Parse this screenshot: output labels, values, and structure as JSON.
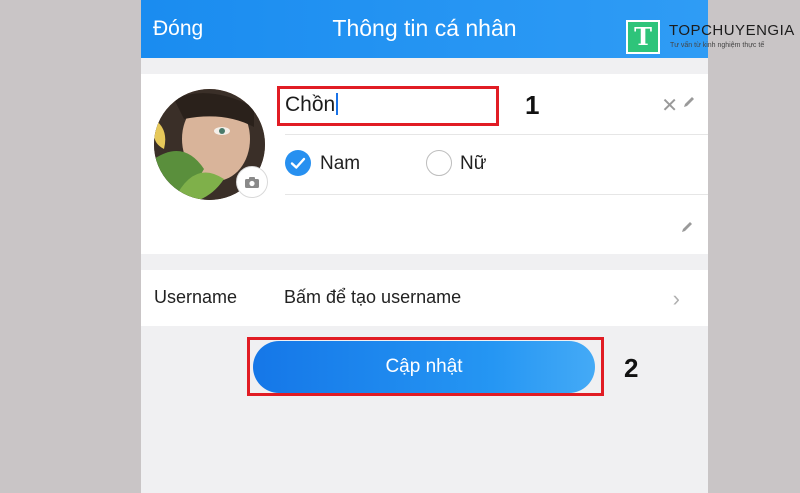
{
  "header": {
    "back_label": "Đóng",
    "title": "Thông tin cá nhân"
  },
  "profile": {
    "name_value": "Chồn",
    "gender_options": [
      {
        "label": "Nam",
        "selected": true
      },
      {
        "label": "Nữ",
        "selected": false
      }
    ]
  },
  "username_row": {
    "label": "Username",
    "value": "Bấm để tạo username"
  },
  "update_button": {
    "label": "Cập nhật"
  },
  "annotations": {
    "step1": "1",
    "step2": "2"
  },
  "watermark": {
    "logo_letter": "T",
    "brand": "TOPCHUYENGIA",
    "tagline": "Tư vấn từ kinh nghiệm thực tế"
  },
  "colors": {
    "header": "#1a8cf0",
    "accent": "#2790f0",
    "highlight": "#e11c24",
    "logo": "#2ec47a"
  },
  "icons": [
    "camera-icon",
    "clear-icon",
    "edit-icon",
    "check-icon",
    "chevron-right-icon"
  ]
}
